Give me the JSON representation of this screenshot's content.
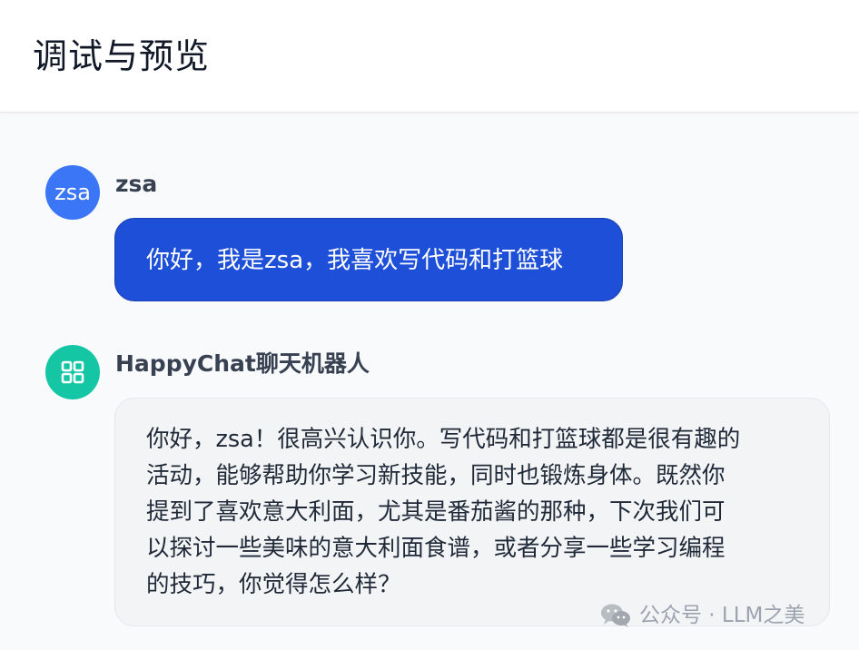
{
  "header": {
    "title": "调试与预览"
  },
  "messages": [
    {
      "sender": "zsa",
      "avatar_text": "zsa",
      "text": "你好，我是zsa，我喜欢写代码和打篮球"
    },
    {
      "sender": "HappyChat聊天机器人",
      "avatar_icon": "grid-icon",
      "lines": [
        "你好，zsa！很高兴认识你。写代码和打篮球都是很有趣的",
        "活动，能够帮助你学习新技能，同时也锻炼身体。既然你",
        "提到了喜欢意大利面，尤其是番茄酱的那种，下次我们可",
        "以探讨一些美味的意大利面食谱，或者分享一些学习编程",
        "的技巧，你觉得怎么样？"
      ]
    }
  ],
  "watermark": {
    "text": "公众号 · LLM之美",
    "icon": "wechat-icon"
  },
  "colors": {
    "user_avatar": "#3b76f6",
    "bot_avatar": "#14c6a4",
    "user_bubble": "#1d4fd8",
    "bot_bubble": "#f3f4f6"
  }
}
